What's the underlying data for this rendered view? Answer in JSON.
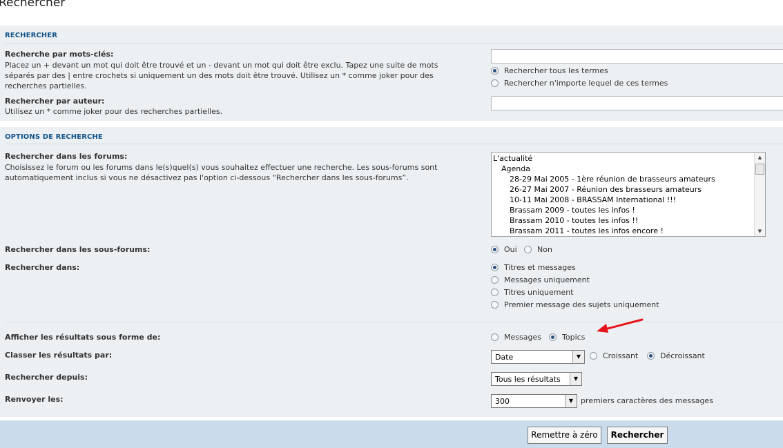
{
  "page": {
    "title": "Rechercher"
  },
  "search_section": {
    "heading": "RECHERCHER",
    "keywords_label": "Recherche par mots-clés:",
    "keywords_desc_1": "Placez un + devant un mot qui doit être trouvé et un - devant un mot qui doit être exclu. Tapez une suite de mots",
    "keywords_desc_2": "séparés par des | entre crochets si uniquement un des mots doit être trouvé. Utilisez un * comme joker pour des",
    "keywords_desc_3": "recherches partielles.",
    "keywords_value": "",
    "terms_all": "Rechercher tous les termes",
    "terms_any": "Rechercher n'importe lequel de ces termes",
    "author_label": "Rechercher par auteur:",
    "author_desc": "Utilisez un * comme joker pour des recherches partielles.",
    "author_value": ""
  },
  "options_section": {
    "heading": "OPTIONS DE RECHERCHE",
    "forums_label": "Rechercher dans les forums:",
    "forums_desc_1": "Choisissez le forum ou les forums dans le(s)quel(s) vous souhaitez effectuer une recherche. Les sous-forums sont",
    "forums_desc_2": "automatiquement inclus si vous ne désactivez pas l'option ci-dessous “Rechercher dans les sous-forums”.",
    "forums": [
      "L'actualité",
      "Agenda",
      "28-29 Mai 2005 - 1ère réunion de brasseurs amateurs",
      "26-27 Mai 2007 - Réunion des brasseurs amateurs",
      "10-11 Mai 2008 - BRASSAM International !!!",
      "Brassam 2009 - toutes les infos !",
      "Brassam 2010 - toutes les infos !!",
      "Brassam 2011 - toutes les infos encore !"
    ],
    "subforums_label": "Rechercher dans les sous-forums:",
    "subforums_yes": "Oui",
    "subforums_no": "Non",
    "search_in_label": "Rechercher dans:",
    "search_in_options": [
      "Titres et messages",
      "Messages uniquement",
      "Titres uniquement",
      "Premier message des sujets uniquement"
    ],
    "display_label": "Afficher les résultats sous forme de:",
    "display_messages": "Messages",
    "display_topics": "Topics",
    "sort_label": "Classer les résultats par:",
    "sort_value": "Date",
    "sort_asc": "Croissant",
    "sort_desc": "Décroissant",
    "since_label": "Rechercher depuis:",
    "since_value": "Tous les résultats",
    "return_label": "Renvoyer les:",
    "return_value": "300",
    "return_suffix": "premiers caractères des messages"
  },
  "footer": {
    "reset_label": "Remettre à zéro",
    "submit_label": "Rechercher"
  },
  "colors": {
    "panel_bg": "#ecf0f3",
    "heading": "#105289",
    "footer_bg": "#cadceb",
    "annotation_arrow": "#e8141b"
  }
}
